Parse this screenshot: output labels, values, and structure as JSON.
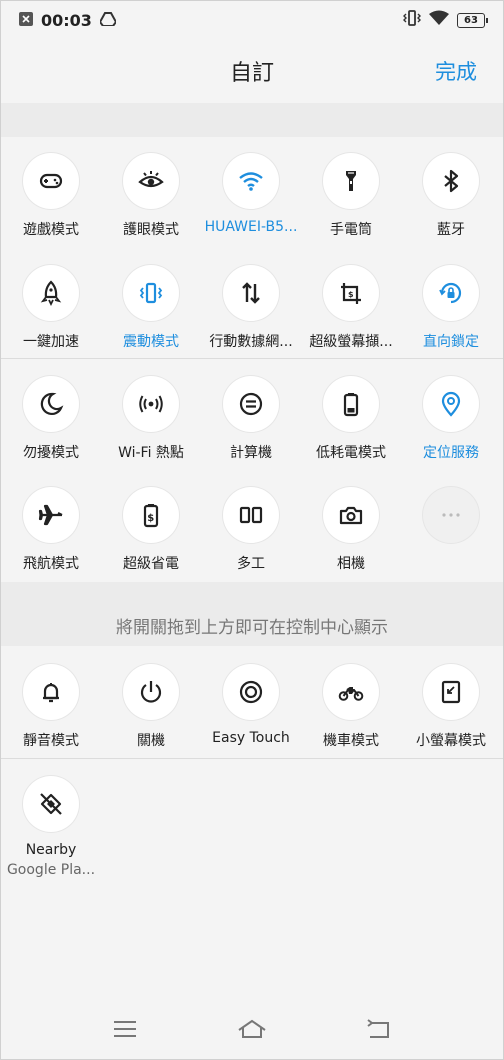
{
  "status_bar": {
    "time": "00:03",
    "battery": "63"
  },
  "header": {
    "title": "自訂",
    "done": "完成"
  },
  "active_tiles": [
    {
      "id": "gaming",
      "label": "遊戲模式",
      "icon": "gamepad-icon",
      "active": false
    },
    {
      "id": "eye",
      "label": "護眼模式",
      "icon": "eye-icon",
      "active": false
    },
    {
      "id": "wifi",
      "label": "HUAWEI-B5...",
      "icon": "wifi-icon",
      "active": true
    },
    {
      "id": "flashlight",
      "label": "手電筒",
      "icon": "flashlight-icon",
      "active": false
    },
    {
      "id": "bluetooth",
      "label": "藍牙",
      "icon": "bluetooth-icon",
      "active": false
    },
    {
      "id": "boost",
      "label": "一鍵加速",
      "icon": "rocket-icon",
      "active": false
    },
    {
      "id": "vibrate",
      "label": "震動模式",
      "icon": "vibrate-icon",
      "active": true
    },
    {
      "id": "mobile-data",
      "label": "行動數據網...",
      "icon": "data-arrows-icon",
      "active": false
    },
    {
      "id": "screenshot",
      "label": "超級螢幕擷...",
      "icon": "screenshot-icon",
      "active": false
    },
    {
      "id": "rotation",
      "label": "直向鎖定",
      "icon": "rotation-lock-icon",
      "active": true
    },
    {
      "id": "dnd",
      "label": "勿擾模式",
      "icon": "moon-icon",
      "active": false
    },
    {
      "id": "hotspot",
      "label": "Wi-Fi 熱點",
      "icon": "hotspot-icon",
      "active": false
    },
    {
      "id": "calculator",
      "label": "計算機",
      "icon": "calculator-icon",
      "active": false
    },
    {
      "id": "low-power",
      "label": "低耗電模式",
      "icon": "battery-icon",
      "active": false
    },
    {
      "id": "location",
      "label": "定位服務",
      "icon": "location-icon",
      "active": true
    },
    {
      "id": "airplane",
      "label": "飛航模式",
      "icon": "airplane-icon",
      "active": false
    },
    {
      "id": "super-saver",
      "label": "超級省電",
      "icon": "super-battery-icon",
      "active": false
    },
    {
      "id": "multitask",
      "label": "多工",
      "icon": "split-screen-icon",
      "active": false
    },
    {
      "id": "camera",
      "label": "相機",
      "icon": "camera-icon",
      "active": false
    },
    {
      "id": "more",
      "label": "",
      "icon": "more-dots-icon",
      "active": false
    }
  ],
  "hint": "將開關拖到上方即可在控制中心顯示",
  "available_tiles": [
    {
      "id": "silent",
      "label": "靜音模式",
      "icon": "bell-icon"
    },
    {
      "id": "power",
      "label": "關機",
      "icon": "power-icon"
    },
    {
      "id": "easy-touch",
      "label": "Easy Touch",
      "icon": "easy-touch-icon"
    },
    {
      "id": "motorbike",
      "label": "機車模式",
      "icon": "motorcycle-icon"
    },
    {
      "id": "small-screen",
      "label": "小螢幕模式",
      "icon": "small-screen-icon"
    },
    {
      "id": "nearby",
      "label": "Nearby",
      "sublabel": "Google Pla...",
      "icon": "nearby-icon"
    }
  ],
  "colors": {
    "accent": "#1e8ede",
    "text": "#222222",
    "background": "#f4f4f4"
  }
}
